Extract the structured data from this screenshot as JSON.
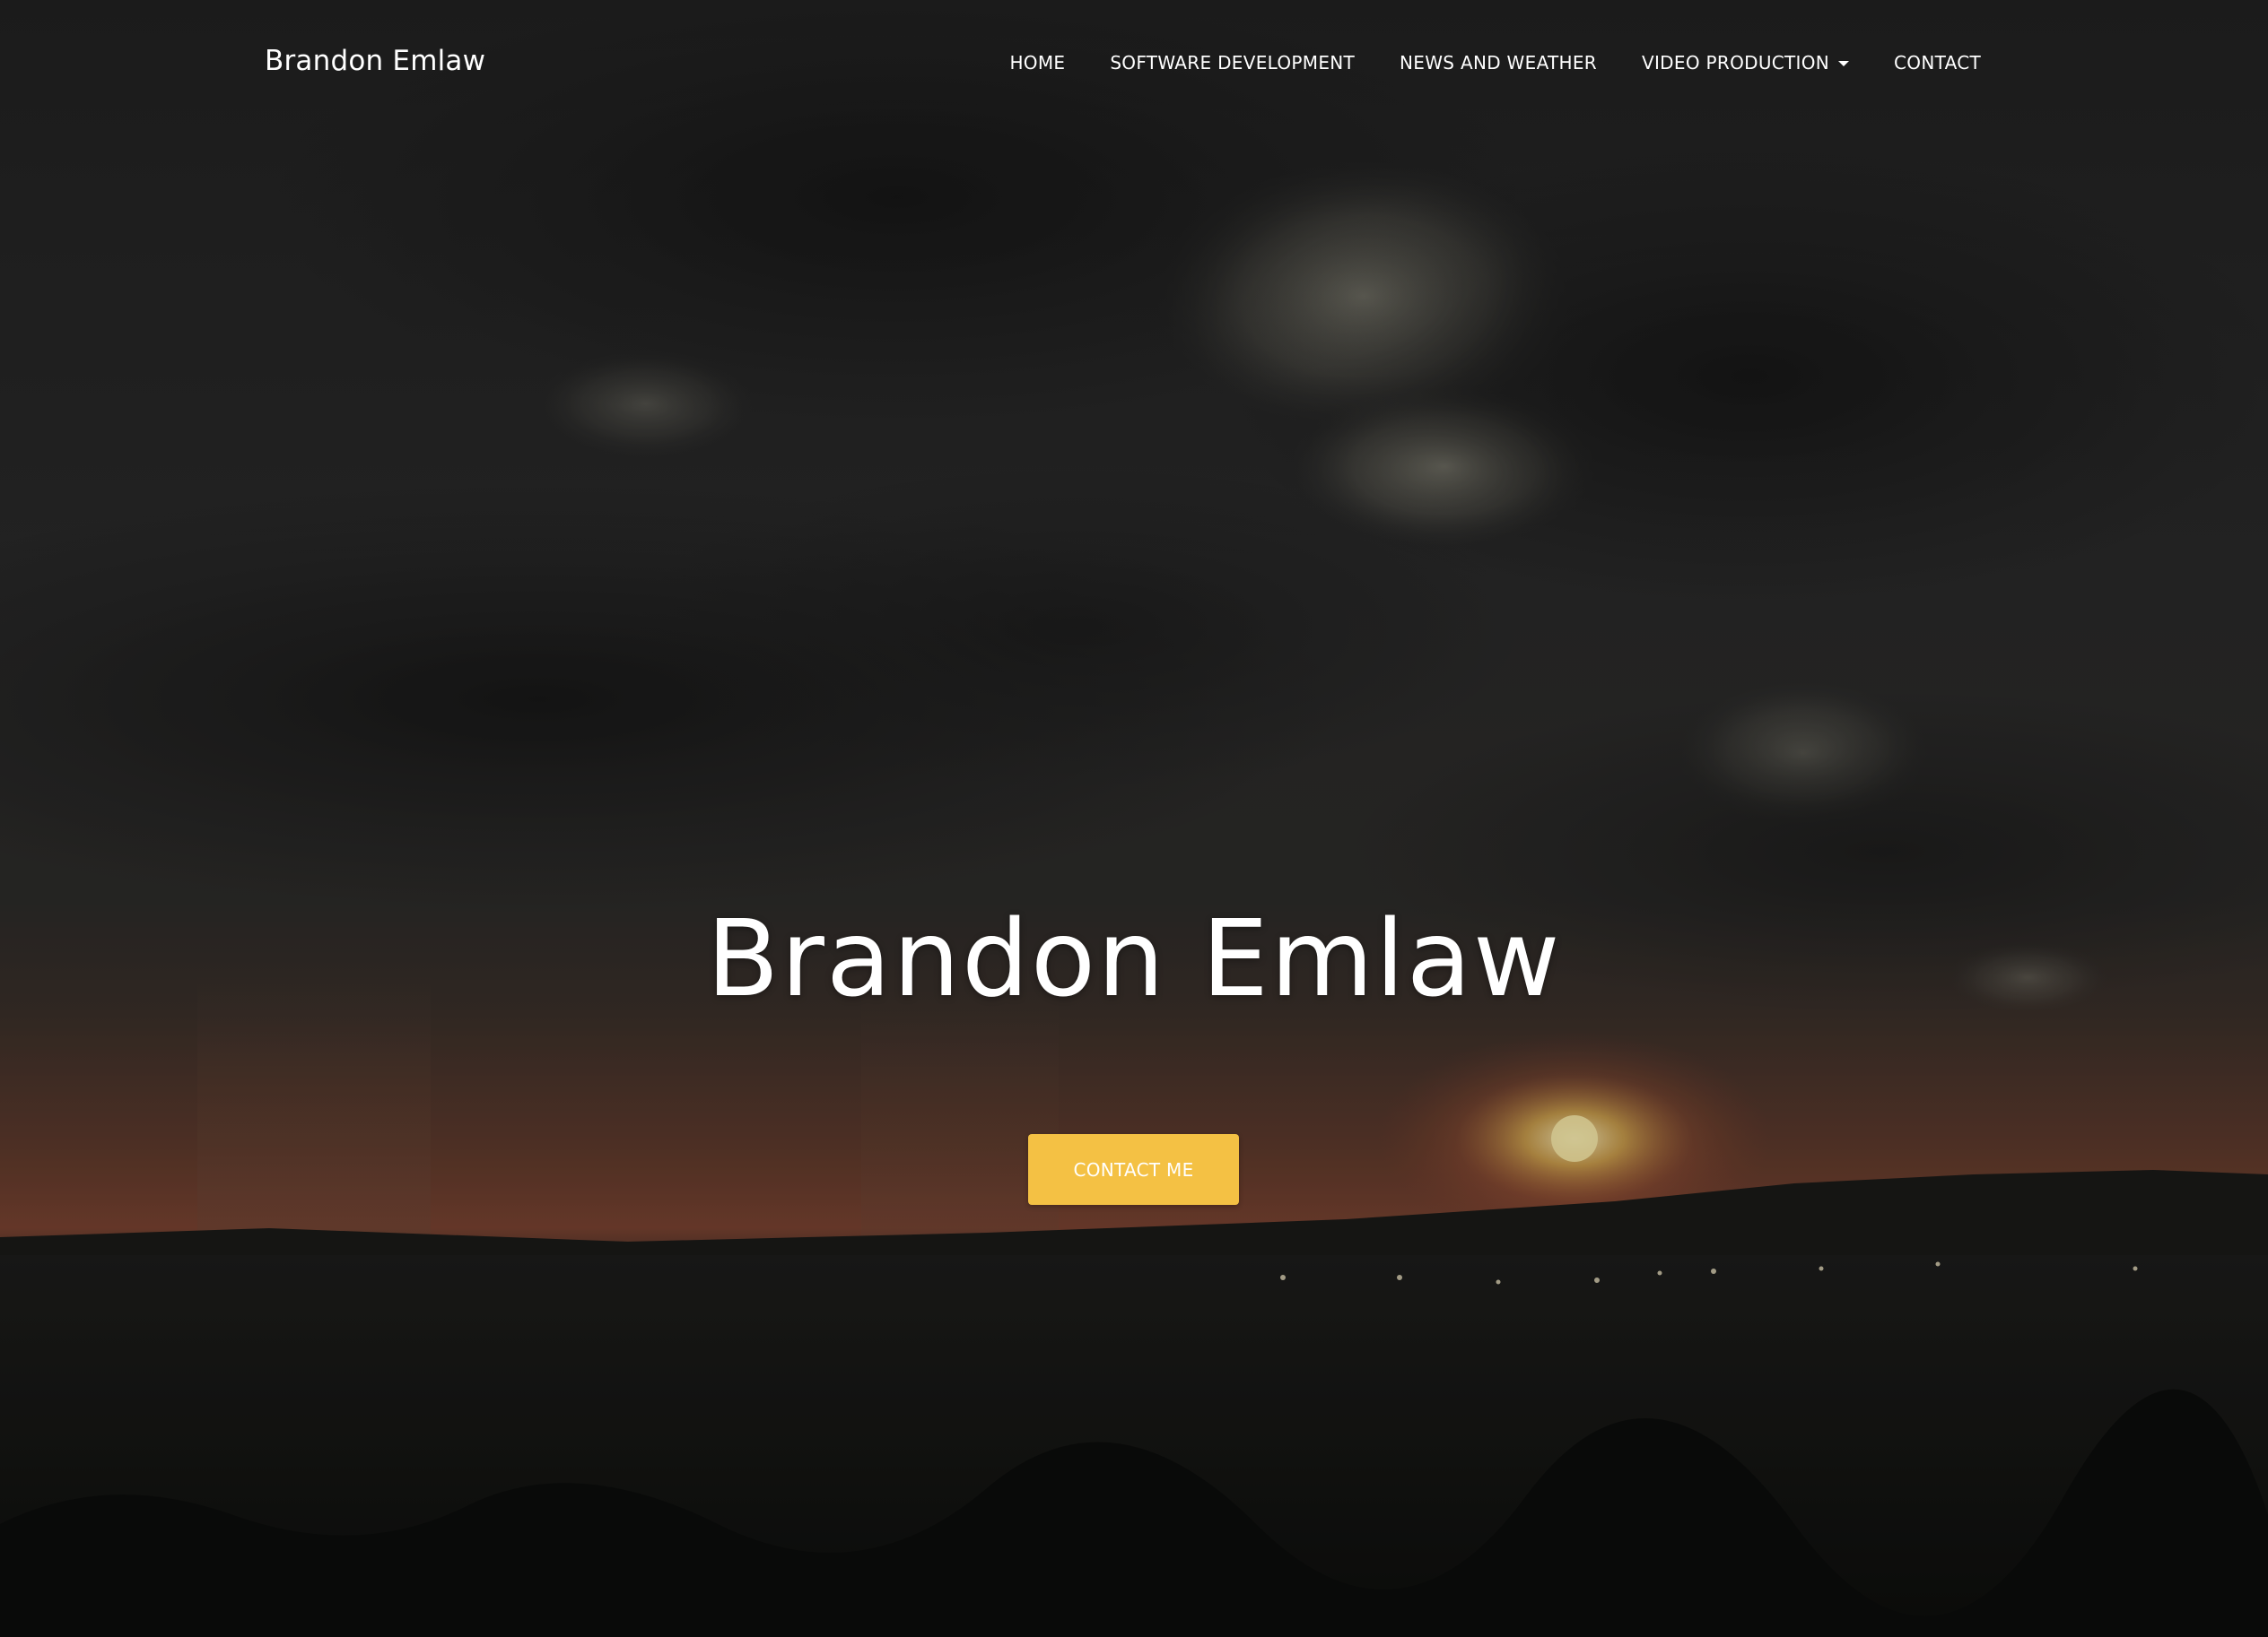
{
  "navbar": {
    "brand": "Brandon Emlaw",
    "items": [
      {
        "label": "HOME"
      },
      {
        "label": "SOFTWARE DEVELOPMENT"
      },
      {
        "label": "NEWS AND WEATHER"
      },
      {
        "label": "VIDEO PRODUCTION",
        "has_dropdown": true
      },
      {
        "label": "CONTACT"
      }
    ]
  },
  "hero": {
    "title": "Brandon Emlaw",
    "cta_label": "CONTACT ME",
    "background": "stormy sunset sky over dark landscape"
  },
  "colors": {
    "accent": "#f4c144",
    "text": "#ffffff",
    "sky_dark": "#2b2b2b",
    "sunset": "#b4553a"
  },
  "icons": {
    "dropdown": "caret-down-icon"
  }
}
